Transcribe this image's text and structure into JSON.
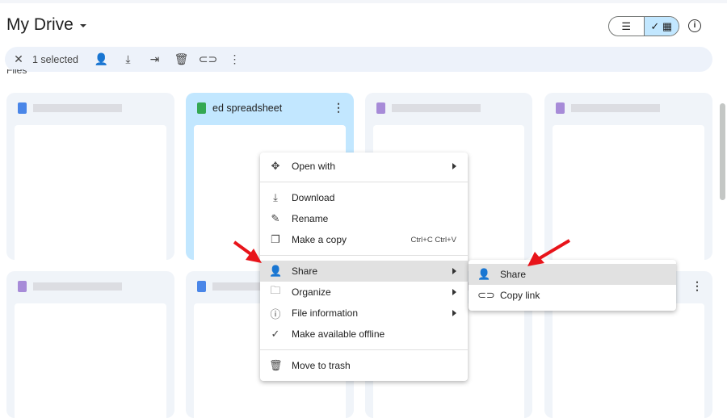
{
  "header": {
    "title": "My Drive",
    "list_view_icon": "list-icon",
    "grid_view_icon": "grid-icon",
    "info_icon": "info-icon"
  },
  "toolbar": {
    "selected": "1 selected",
    "actions": [
      "close-icon",
      "share-icon",
      "download-icon",
      "move-icon",
      "trash-icon",
      "link-icon",
      "more-icon"
    ]
  },
  "section": "Files",
  "cards": [
    {
      "name": ""
    },
    {
      "name": "ed spreadsheet",
      "selected": true
    },
    {
      "name": ""
    },
    {
      "name": ""
    },
    {
      "name": ""
    },
    {
      "name": ""
    },
    {
      "name": ""
    },
    {
      "name": ""
    }
  ],
  "context_menu": {
    "items": [
      {
        "icon": "open-with-icon",
        "glyph": "✥",
        "label": "Open with",
        "submenu": true
      },
      {
        "divider": true
      },
      {
        "icon": "download-icon",
        "glyph": "⤓",
        "label": "Download"
      },
      {
        "icon": "rename-icon",
        "glyph": "✎",
        "label": "Rename"
      },
      {
        "icon": "copy-icon",
        "glyph": "❐",
        "label": "Make a copy",
        "shortcut": "Ctrl+C Ctrl+V"
      },
      {
        "divider": true
      },
      {
        "icon": "share-icon",
        "glyph": "👤",
        "label": "Share",
        "submenu": true,
        "highlighted": true
      },
      {
        "icon": "folder-icon",
        "glyph": "🗀",
        "label": "Organize",
        "submenu": true
      },
      {
        "icon": "info-icon",
        "glyph": "ⓘ",
        "label": "File information",
        "submenu": true
      },
      {
        "icon": "offline-icon",
        "glyph": "✓",
        "label": "Make available offline"
      },
      {
        "divider": true
      },
      {
        "icon": "trash-icon",
        "glyph": "🗑",
        "label": "Move to trash"
      }
    ]
  },
  "submenu": {
    "items": [
      {
        "icon": "share-icon",
        "glyph": "👤",
        "label": "Share",
        "highlighted": true
      },
      {
        "icon": "link-icon",
        "glyph": "⊂⊃",
        "label": "Copy link"
      }
    ]
  },
  "colors": {
    "selected_card": "#c2e7ff",
    "highlight": "#e1e1e1",
    "arrow": "#e8141a"
  }
}
